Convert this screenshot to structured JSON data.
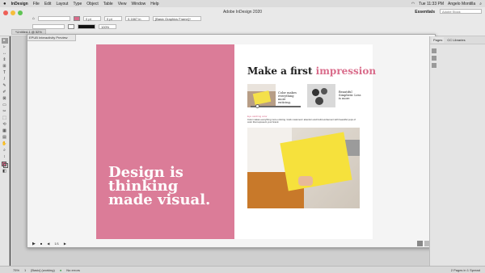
{
  "menubar": {
    "app": "InDesign",
    "items": [
      "File",
      "Edit",
      "Layout",
      "Type",
      "Object",
      "Table",
      "View",
      "Window",
      "Help"
    ],
    "clock": "Tue 11:33 PM",
    "user": "Angelo Montilla"
  },
  "titlebar": {
    "title": "Adobe InDesign 2020",
    "workspace": "Essentials",
    "search_placeholder": "Adobe Stock",
    "x_field": "0 pt",
    "stroke_weight": "0 pt",
    "zoom": "100%",
    "size_field": "0.1667 in",
    "frame_label": "[Basic Graphics Frame]+",
    "fill_color": "#d96b8a"
  },
  "tabs": {
    "document": "*Untitled-1 @ 52%",
    "preview": "EPUB Interactivity Preview"
  },
  "tools": [
    "▸",
    "▹",
    "↔",
    "⇕",
    "⊞",
    "T",
    "/",
    "✎",
    "✐",
    "⊠",
    "▭",
    "✂",
    "⬚",
    "⟲",
    "▦",
    "▤",
    "✋",
    "⌕",
    "↕",
    "◧"
  ],
  "spread": {
    "hero_line1": "Design is",
    "hero_line2": "thinking",
    "hero_line3": "made visual.",
    "title_plain": "Make a first ",
    "title_accent": "impression",
    "caption1": "Color makes everything more enticing.",
    "caption2": "Beautiful Simplistic Less is more",
    "kicker": "Eye catching color",
    "body": "Color makes everything more enticing. Grab customers' attention and build excitement with beautiful pops of color that represent your brand.",
    "accent_color": "#d96b8a"
  },
  "preview_controls": {
    "page": "1/1"
  },
  "rightpanel": {
    "tabs": [
      "Pages",
      "CC Libraries"
    ]
  },
  "statusbar": {
    "zoom": "75%",
    "page": "1",
    "style": "[Basic] (working)",
    "errors": "No errors",
    "spreads": "2 Pages in 1 Spread"
  }
}
